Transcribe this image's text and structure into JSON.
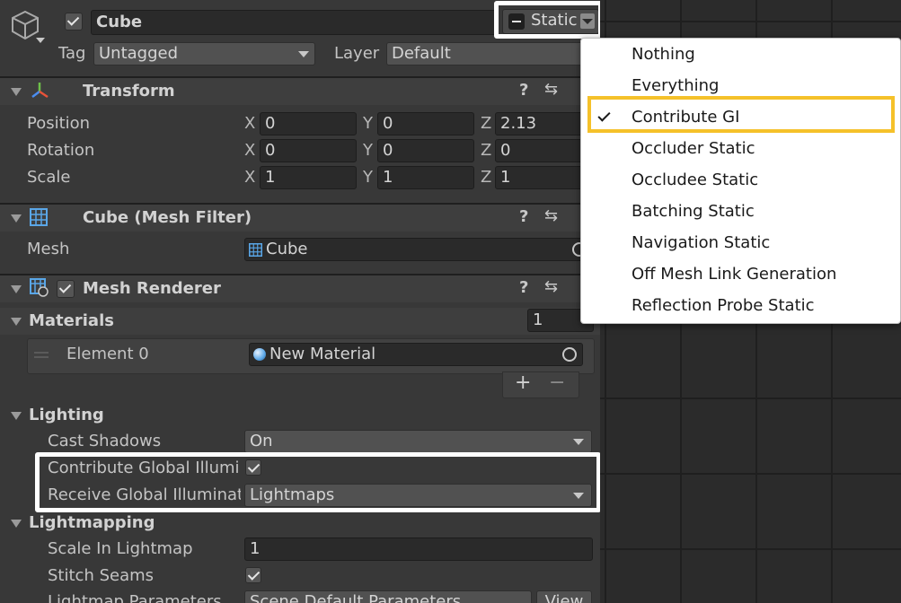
{
  "gameobject": {
    "name": "Cube",
    "active": true,
    "static_label": "Static",
    "tag_label": "Tag",
    "tag_value": "Untagged",
    "layer_label": "Layer",
    "layer_value": "Default"
  },
  "transform": {
    "title": "Transform",
    "rows": [
      {
        "label": "Position",
        "x": "0",
        "y": "0",
        "z": "2.13"
      },
      {
        "label": "Rotation",
        "x": "0",
        "y": "0",
        "z": "0"
      },
      {
        "label": "Scale",
        "x": "1",
        "y": "1",
        "z": "1"
      }
    ],
    "axes": {
      "x": "X",
      "y": "Y",
      "z": "Z"
    }
  },
  "mesh_filter": {
    "title": "Cube (Mesh Filter)",
    "mesh_label": "Mesh",
    "mesh_value": "Cube"
  },
  "mesh_renderer": {
    "title": "Mesh Renderer",
    "materials_label": "Materials",
    "materials_count": "1",
    "element_label": "Element 0",
    "element_value": "New Material",
    "add_label": "+",
    "remove_label": "−",
    "lighting_label": "Lighting",
    "cast_shadows_label": "Cast Shadows",
    "cast_shadows_value": "On",
    "contribute_gi_label": "Contribute Global Illumin",
    "receive_gi_label": "Receive Global Illuminati",
    "receive_gi_value": "Lightmaps",
    "lightmapping_label": "Lightmapping",
    "scale_lightmap_label": "Scale In Lightmap",
    "scale_lightmap_value": "1",
    "stitch_seams_label": "Stitch Seams",
    "lightmap_params_label": "Lightmap Parameters",
    "lightmap_params_value": "Scene Default Parameters",
    "view_label": "View"
  },
  "static_menu": {
    "items": [
      "Nothing",
      "Everything",
      "Contribute GI",
      "Occluder Static",
      "Occludee Static",
      "Batching Static",
      "Navigation Static",
      "Off Mesh Link Generation",
      "Reflection Probe Static"
    ],
    "checked_index": 2
  },
  "colors": {
    "highlight_box": "#f5c12a",
    "callout_box": "#ffffff",
    "panel_bg": "#383838",
    "header_bg": "#3e3e3e"
  }
}
